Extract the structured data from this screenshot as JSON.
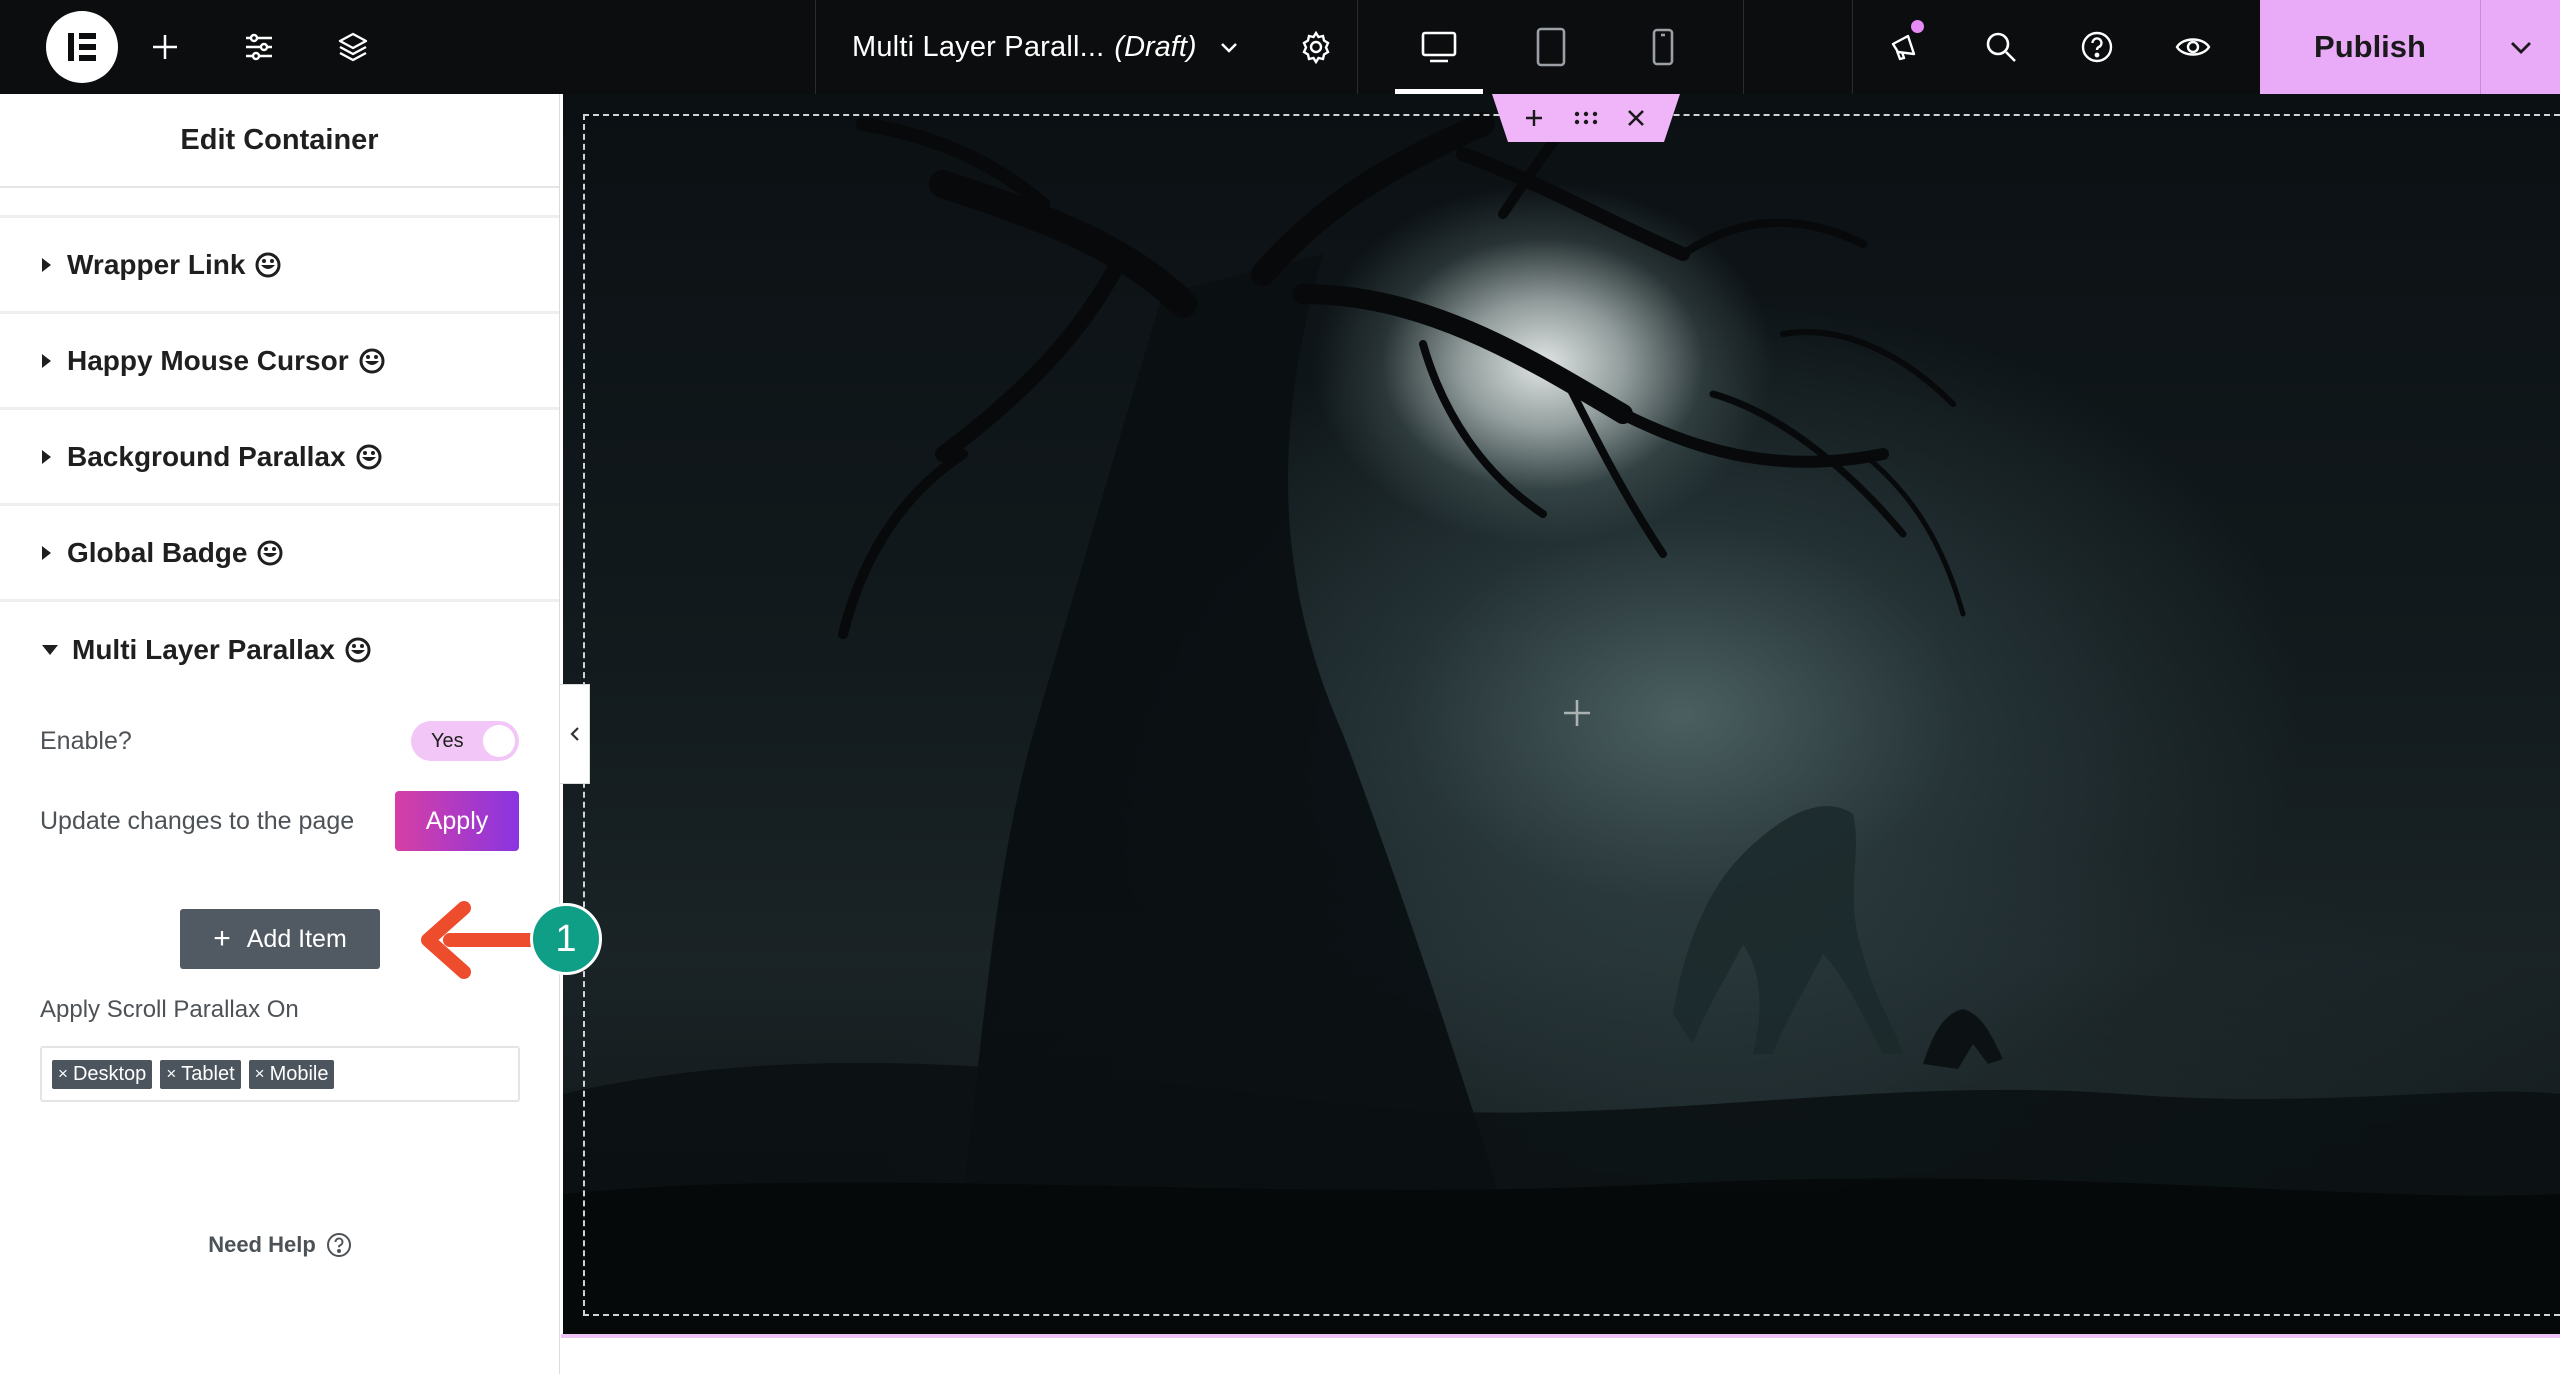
{
  "topbar": {
    "document_title": "Multi Layer Parall...",
    "document_status": "(Draft)",
    "publish_label": "Publish"
  },
  "panel": {
    "title": "Edit Container",
    "sections": [
      {
        "label": "Wrapper Link",
        "open": false
      },
      {
        "label": "Happy Mouse Cursor",
        "open": false
      },
      {
        "label": "Background Parallax",
        "open": false
      },
      {
        "label": "Global Badge",
        "open": false
      },
      {
        "label": "Multi Layer Parallax",
        "open": true
      }
    ],
    "multi_layer": {
      "enable_label": "Enable?",
      "enable_value": "Yes",
      "update_label": "Update changes to the page",
      "apply_label": "Apply",
      "add_item_label": "Add Item",
      "scroll_label": "Apply Scroll Parallax On",
      "devices": [
        "Desktop",
        "Tablet",
        "Mobile"
      ]
    },
    "need_help": "Need Help"
  },
  "annotation": {
    "step_number": "1"
  },
  "colors": {
    "accent": "#e9aaf7",
    "apply_gradient_start": "#d63fa5",
    "apply_gradient_end": "#8a35e0",
    "step_badge": "#0f9e86",
    "annotation_arrow": "#ee4d2d"
  }
}
